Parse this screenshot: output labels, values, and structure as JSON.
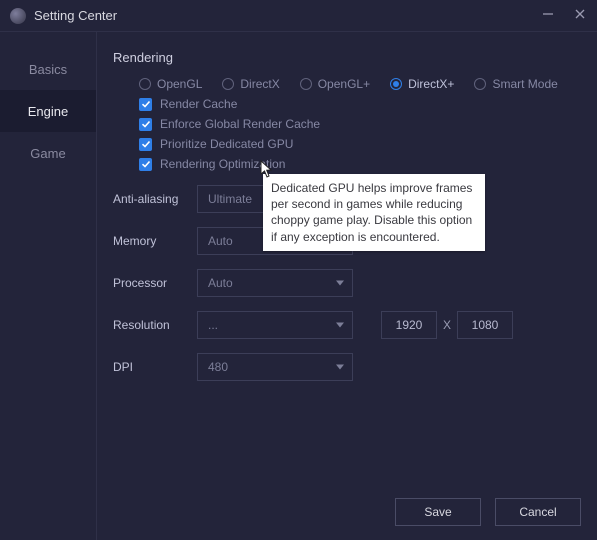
{
  "window": {
    "title": "Setting Center"
  },
  "sidebar": {
    "items": [
      "Basics",
      "Engine",
      "Game"
    ],
    "active_index": 1
  },
  "section": {
    "title": "Rendering"
  },
  "render_modes": {
    "options": [
      "OpenGL",
      "DirectX",
      "OpenGL+",
      "DirectX+",
      "Smart Mode"
    ],
    "selected_index": 3
  },
  "checks": {
    "render_cache": "Render Cache",
    "enforce_global": "Enforce Global Render Cache",
    "prioritize_gpu": "Prioritize Dedicated GPU",
    "rendering_opt": "Rendering Optimization"
  },
  "labels": {
    "anti_aliasing": "Anti-aliasing",
    "memory": "Memory",
    "processor": "Processor",
    "resolution": "Resolution",
    "dpi": "DPI",
    "res_x": "X"
  },
  "values": {
    "anti_aliasing": "Ultimate",
    "memory": "Auto",
    "processor": "Auto",
    "resolution": "...",
    "dpi": "480",
    "res_w": "1920",
    "res_h": "1080"
  },
  "tooltip": {
    "text": "Dedicated GPU helps improve frames per second in games while reducing choppy game play. Disable this option if any exception is encountered."
  },
  "buttons": {
    "save": "Save",
    "cancel": "Cancel"
  }
}
